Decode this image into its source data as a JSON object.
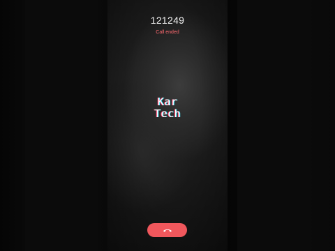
{
  "call": {
    "number": "121249",
    "status": "Call ended"
  },
  "logo": {
    "line1": "Kar",
    "line2": "Tech"
  },
  "controls": {
    "end_call_icon": "phone-hangup-icon"
  },
  "colors": {
    "status_text": "#ff6a70",
    "end_call_button": "#f0575c",
    "background": "#000000"
  }
}
